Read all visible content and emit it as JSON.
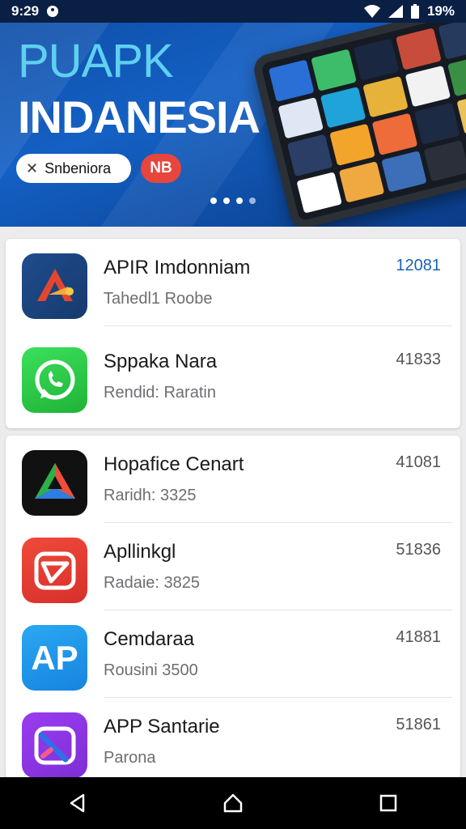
{
  "status_bar": {
    "time": "9:29",
    "battery_text": "19%"
  },
  "banner": {
    "title_line1": "PUAPK",
    "title_line2": "INDANESIA",
    "chip_label": "Snbeniora",
    "badge_label": "NB",
    "pager_total": 4,
    "pager_active": 0
  },
  "card1": {
    "items": [
      {
        "name": "APIR Imdonniam",
        "subtitle": "Tahedl1 Roobe",
        "count": "12081",
        "icon": "adobe-style-icon"
      },
      {
        "name": "Sppaka Nara",
        "subtitle": "Rendid: Raratin",
        "count": "41833",
        "icon": "whatsapp-icon"
      }
    ]
  },
  "card2": {
    "items": [
      {
        "name": "Hopafice Cenart",
        "subtitle": "Raridh: 3325",
        "count": "41081",
        "icon": "play-triangle-icon"
      },
      {
        "name": "Apllinkgl",
        "subtitle": "Radaie: 3825",
        "count": "51836",
        "icon": "mail-icon"
      },
      {
        "name": "Cemdaraa",
        "subtitle": "Rousini 3500",
        "count": "41881",
        "icon": "ap-letters-icon"
      },
      {
        "name": "APP Santarie",
        "subtitle": "Parona",
        "count": "51861",
        "icon": "slash-icon"
      }
    ],
    "ap_icon_text": "AP"
  },
  "colors": {
    "banner_blue": "#1460c4",
    "accent_red": "#e8453c",
    "count_blue": "#1b63b8"
  }
}
